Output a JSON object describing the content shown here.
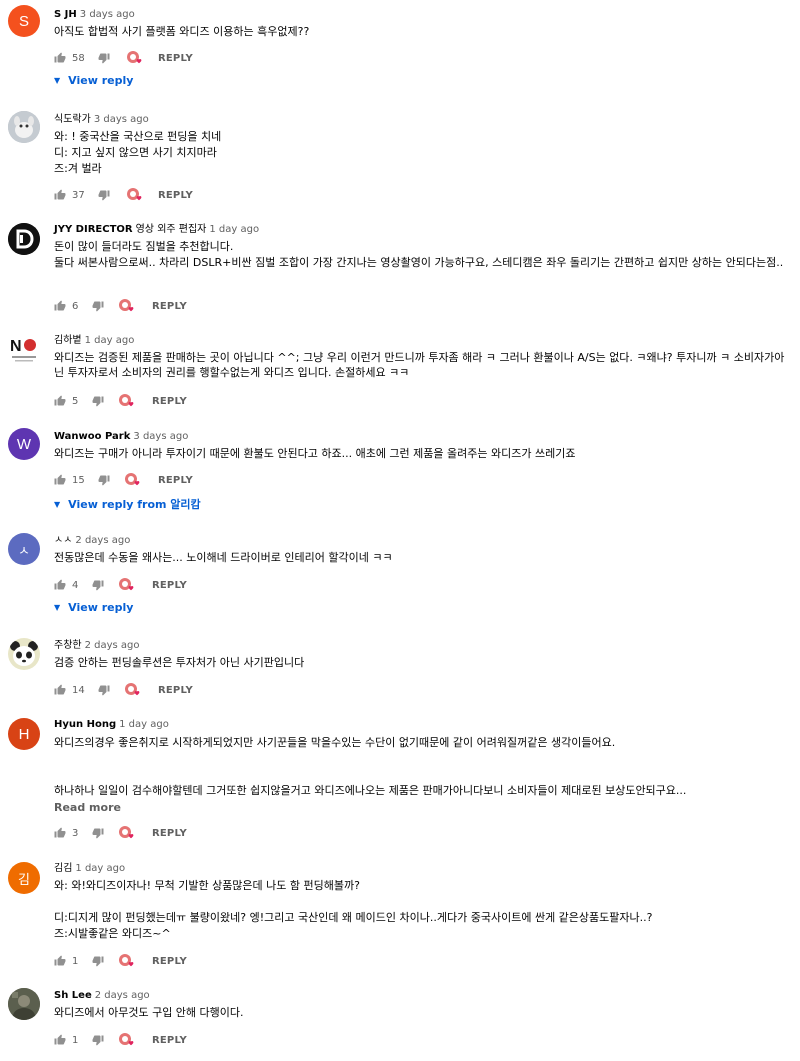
{
  "reply_label": "REPLY",
  "read_more_label": "Read more",
  "colors": {
    "link": "#065fd4",
    "meta": "#606060",
    "heart": "#e0245e"
  },
  "comments": [
    {
      "author": "S JH",
      "time": "3 days ago",
      "avatar_letter": "S",
      "avatar_color": "#f4511e",
      "lines": [
        "아직도 합법적 사기 플랫폼 와디즈 이용하는 흑우없제??"
      ],
      "likes": "58",
      "view_reply": "View reply"
    },
    {
      "author": "식도락가",
      "time": "3 days ago",
      "avatar_letter": "",
      "avatar_color": "#9aa0a6",
      "lines": [
        "와: ! 중국산을 국산으로 펀딩을 치네",
        "디: 지고 싶지 않으면 사기 치지마라",
        "즈:겨 벌라"
      ],
      "likes": "37"
    },
    {
      "author": "JYY DIRECTOR",
      "author_extra": "영상 외주 편집자",
      "time": "1 day ago",
      "avatar_letter": "D",
      "avatar_color": "#111111",
      "lines": [
        "돈이 많이 들더라도 짐벌을 추천합니다.",
        "둘다 써본사람으로써.. 차라리 DSLR+비싼 짐벌 조합이 가장 간지나는 영상촬영이 가능하구요, 스테디캠은 좌우 돌리기는 간편하고 쉽지만 상하는 안되다는점.."
      ],
      "likes": "6"
    },
    {
      "author": "김하볕",
      "time": "1 day ago",
      "avatar_letter": "NO",
      "avatar_color": "#ffffff",
      "lines": [
        "와디즈는 검증된 제품을 판매하는 곳이 아닙니다 ^^; 그냥 우리 이런거 만드니까 투자좀 해라 ㅋ 그러나 환불이나 A/S는 없다. ㅋ왜냐? 투자니까 ㅋ 소비자가아닌 투자자로서 소비자의 권리를 행할수없는게 와디즈 입니다. 손절하세요 ㅋㅋ"
      ],
      "likes": "5"
    },
    {
      "author": "Wanwoo Park",
      "time": "3 days ago",
      "avatar_letter": "W",
      "avatar_color": "#5e35b1",
      "lines": [
        "와디즈는 구매가 아니라 투자이기 때문에 환불도 안된다고 하죠... 애초에 그런 제품을 올려주는 와디즈가 쓰레기죠"
      ],
      "likes": "15",
      "view_reply": "View reply from 알리캄"
    },
    {
      "author": "ㅅㅅ",
      "time": "2 days ago",
      "avatar_letter": "ㅅ",
      "avatar_color": "#5c6bc0",
      "lines": [
        "전동많은데 수동을 왜사는... 노이해네  드라이버로 인테리어 할각이네 ㅋㅋ"
      ],
      "likes": "4",
      "view_reply": "View reply"
    },
    {
      "author": "주창한",
      "time": "2 days ago",
      "avatar_letter": "",
      "avatar_color": "#f5f5dc",
      "lines": [
        "검증 안하는 펀딩솔루션은 투자처가 아닌 사기판입니다"
      ],
      "likes": "14"
    },
    {
      "author": "Hyun Hong",
      "time": "1 day ago",
      "avatar_letter": "H",
      "avatar_color": "#d84315",
      "lines": [
        "와디즈의경우 좋은취지로 시작하게되었지만 사기꾼들을 막을수있는 수단이 없기때문에 같이 어려워질꺼같은 생각이들어요.",
        "",
        "",
        "하나하나 일일이 검수해야할텐데 그거또한 쉽지않을거고 와디즈에나오는 제품은 판매가아니다보니 소비자들이 제대로된 보상도안되구요..."
      ],
      "likes": "3",
      "read_more": true
    },
    {
      "author": "김김",
      "time": "1 day ago",
      "avatar_letter": "김",
      "avatar_color": "#ef6c00",
      "lines": [
        "와:  와!와디즈이자나! 무척 기발한 상품많은데 나도 함 펀딩해볼까?",
        "",
        "디:디지게 많이 펀딩했는데ㅠ 불량이왔네? 엥!그리고 국산인데 왜 메이드인 차이나..게다가 중국사이트에 싼게 같은상품도팔자나..?",
        "즈:시발좋같은 와디즈~^"
      ],
      "likes": "1"
    },
    {
      "author": "Sh Lee",
      "time": "2 days ago",
      "avatar_letter": "",
      "avatar_color": "#6d6d5a",
      "lines": [
        "와디즈에서 아무것도 구입 안해 다행이다."
      ],
      "likes": "1"
    }
  ]
}
